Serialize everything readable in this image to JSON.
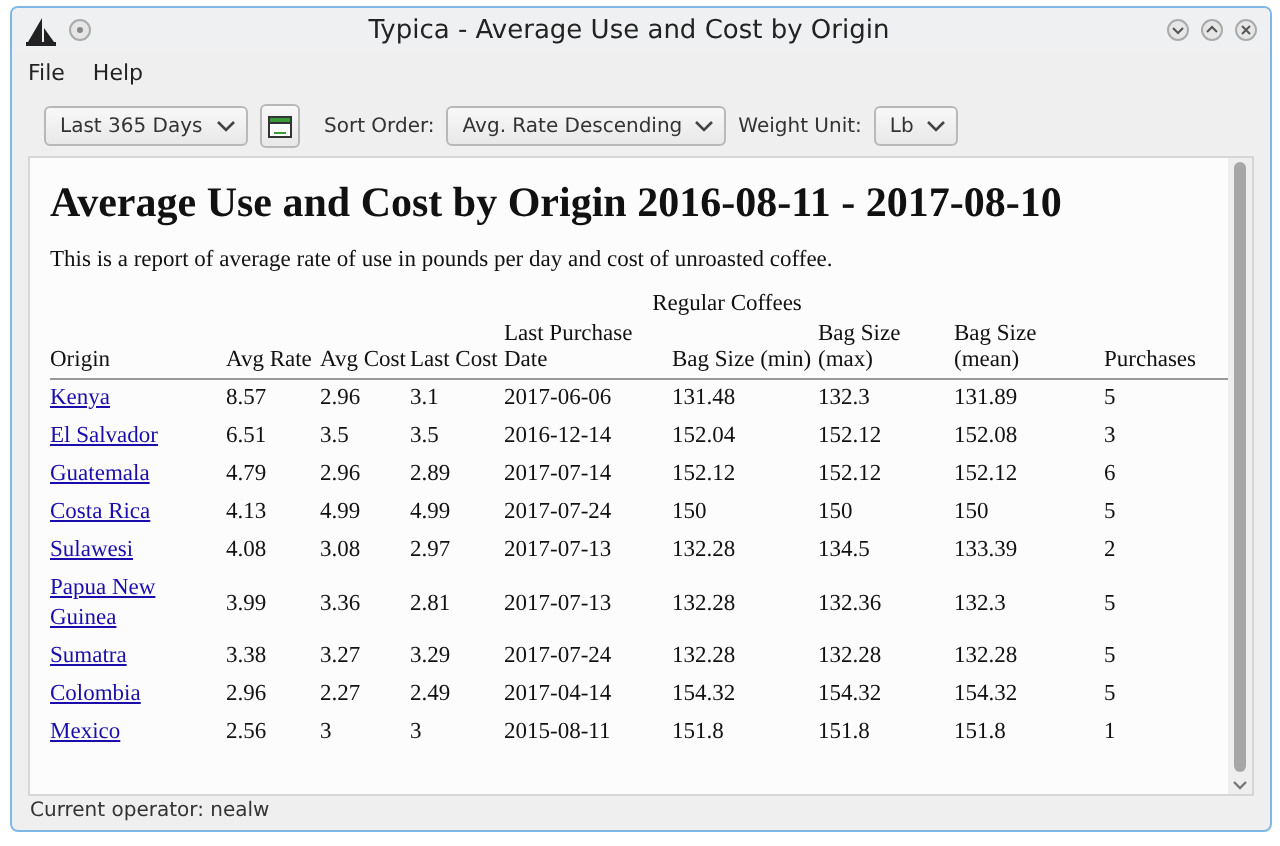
{
  "window": {
    "title": "Typica - Average Use and Cost by Origin"
  },
  "menu": [
    "File",
    "Help"
  ],
  "toolbar": {
    "period": "Last 365 Days",
    "sort_label": "Sort Order:",
    "sort": "Avg. Rate Descending",
    "weight_label": "Weight Unit:",
    "weight": "Lb"
  },
  "report": {
    "title": "Average Use and Cost by Origin 2016-08-11 - 2017-08-10",
    "description": "This is a report of average rate of use in pounds per day and cost of unroasted coffee.",
    "table": {
      "group_header": "Regular Coffees",
      "columns": [
        "Origin",
        "Avg Rate",
        "Avg Cost",
        "Last Cost",
        "Last Purchase Date",
        "Bag Size (min)",
        "Bag Size (max)",
        "Bag Size (mean)",
        "Purchases"
      ],
      "rows": [
        {
          "origin": "Kenya",
          "values": [
            "8.57",
            "2.96",
            "3.1",
            "2017-06-06",
            "131.48",
            "132.3",
            "131.89",
            "5"
          ]
        },
        {
          "origin": "El Salvador",
          "values": [
            "6.51",
            "3.5",
            "3.5",
            "2016-12-14",
            "152.04",
            "152.12",
            "152.08",
            "3"
          ]
        },
        {
          "origin": "Guatemala",
          "values": [
            "4.79",
            "2.96",
            "2.89",
            "2017-07-14",
            "152.12",
            "152.12",
            "152.12",
            "6"
          ]
        },
        {
          "origin": "Costa Rica",
          "values": [
            "4.13",
            "4.99",
            "4.99",
            "2017-07-24",
            "150",
            "150",
            "150",
            "5"
          ]
        },
        {
          "origin": "Sulawesi",
          "values": [
            "4.08",
            "3.08",
            "2.97",
            "2017-07-13",
            "132.28",
            "134.5",
            "133.39",
            "2"
          ]
        },
        {
          "origin": "Papua New Guinea",
          "values": [
            "3.99",
            "3.36",
            "2.81",
            "2017-07-13",
            "132.28",
            "132.36",
            "132.3",
            "5"
          ]
        },
        {
          "origin": "Sumatra",
          "values": [
            "3.38",
            "3.27",
            "3.29",
            "2017-07-24",
            "132.28",
            "132.28",
            "132.28",
            "5"
          ]
        },
        {
          "origin": "Colombia",
          "values": [
            "2.96",
            "2.27",
            "2.49",
            "2017-04-14",
            "154.32",
            "154.32",
            "154.32",
            "5"
          ]
        },
        {
          "origin": "Mexico",
          "values": [
            "2.56",
            "3",
            "3",
            "2015-08-11",
            "151.8",
            "151.8",
            "151.8",
            "1"
          ]
        }
      ]
    }
  },
  "status_bar": "Current operator: nealw"
}
